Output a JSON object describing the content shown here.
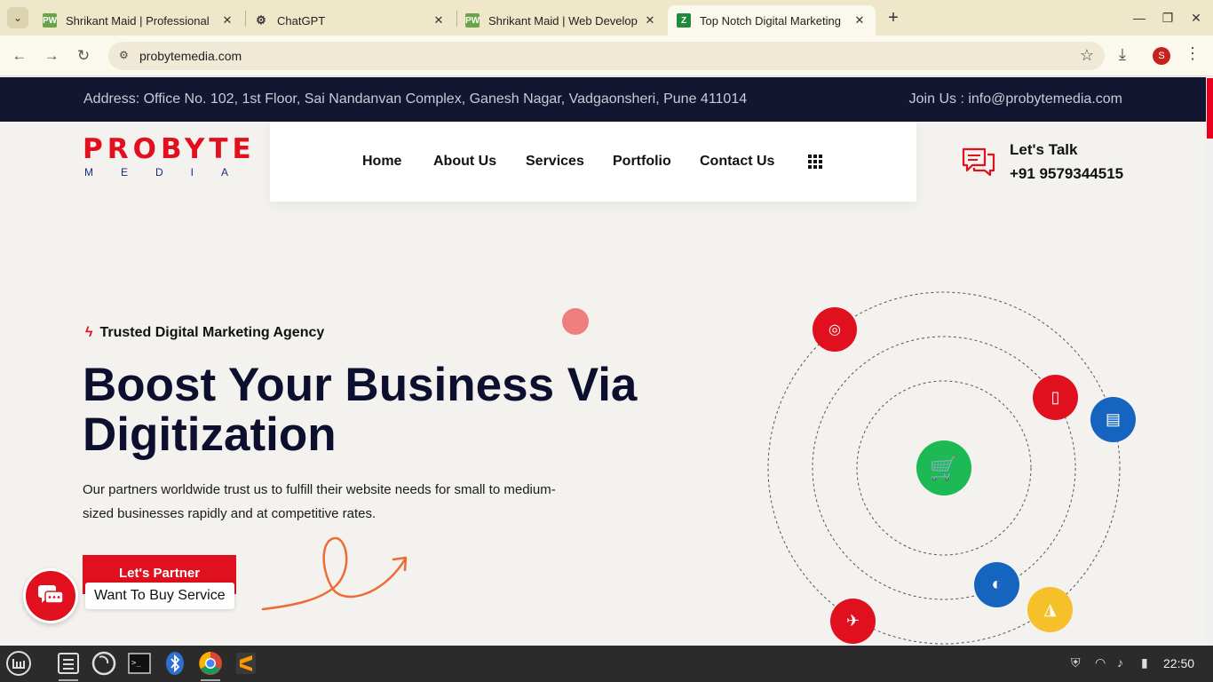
{
  "browser": {
    "tabs": [
      {
        "title": "Shrikant Maid | Professional",
        "favicon": "pw-icon",
        "active": false
      },
      {
        "title": "ChatGPT",
        "favicon": "chatgpt-icon",
        "active": false
      },
      {
        "title": "Shrikant Maid | Web Develop",
        "favicon": "pw-icon",
        "active": false
      },
      {
        "title": "Top Notch Digital Marketing",
        "favicon": "z-icon",
        "active": true
      }
    ],
    "favicon_text": {
      "pw": "PW",
      "z": "Z"
    },
    "url": "probytemedia.com",
    "profile_initial": "S"
  },
  "site": {
    "topbar": {
      "address": "Address: Office No. 102, 1st Floor, Sai Nandanvan Complex, Ganesh Nagar, Vadgaonsheri, Pune 411014",
      "join": "Join Us : info@probytemedia.com"
    },
    "logo": {
      "line1": "PROBYTE",
      "line2": "MEDIA"
    },
    "nav": [
      "Home",
      "About Us",
      "Services",
      "Portfolio",
      "Contact Us"
    ],
    "talk": {
      "label": "Let's Talk",
      "phone": "+91 9579344515"
    },
    "hero": {
      "tagline": "Trusted Digital Marketing Agency",
      "title": "Boost Your Business Via Digitization",
      "subtitle": "Our partners worldwide trust us to fulfill their website needs for small to medium-sized businesses rapidly and at competitive rates.",
      "cta": "Let's Partner"
    },
    "chat": {
      "tooltip": "Want To Buy Service"
    },
    "colors": {
      "brand_red": "#e0101e",
      "navy": "#131630",
      "green": "#1db954",
      "blue": "#1565c0",
      "yellow": "#f5c02a"
    }
  },
  "taskbar": {
    "apps": [
      "mint-menu-icon",
      "files-icon",
      "firefox-icon",
      "terminal-icon",
      "bluetooth-icon",
      "chrome-icon",
      "sublime-icon"
    ],
    "clock": "22:50"
  }
}
